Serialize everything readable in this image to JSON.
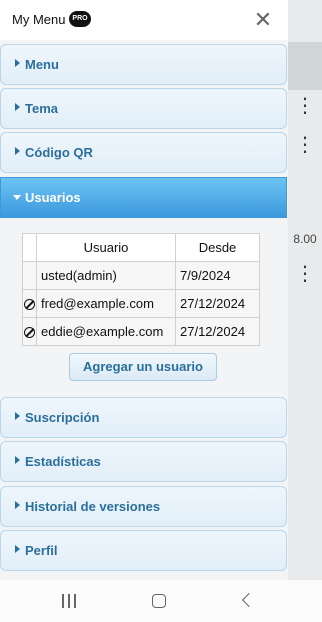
{
  "header": {
    "title": "My Menu",
    "pro_badge": "PRO"
  },
  "sections_top": [
    {
      "label": "Menu"
    },
    {
      "label": "Tema"
    },
    {
      "label": "Código QR"
    },
    {
      "label": "Usuarios"
    }
  ],
  "users": {
    "columns": [
      "Usuario",
      "Desde"
    ],
    "rows": [
      {
        "user": "usted(admin)",
        "since": "7/9/2024",
        "blocked": false
      },
      {
        "user": "fred@example.com",
        "since": "27/12/2024",
        "blocked": true
      },
      {
        "user": "eddie@example.com",
        "since": "27/12/2024",
        "blocked": true
      }
    ],
    "add_button": "Agregar un usuario"
  },
  "sections_bottom": [
    {
      "label": "Suscripción"
    },
    {
      "label": "Estadísticas"
    },
    {
      "label": "Historial de versiones"
    },
    {
      "label": "Perfil"
    }
  ],
  "background": {
    "value": "8.00"
  },
  "icons": {
    "close": "close-icon",
    "expand": "chevron-right-icon",
    "collapse": "chevron-down-icon",
    "blocked": "block-icon",
    "more": "more-vertical-icon",
    "nav": [
      "recents-icon",
      "home-icon",
      "back-icon"
    ]
  },
  "colors": {
    "section_text": "#2b6f9b",
    "active_section": "#3d98dd",
    "badge_bg": "#111111"
  }
}
